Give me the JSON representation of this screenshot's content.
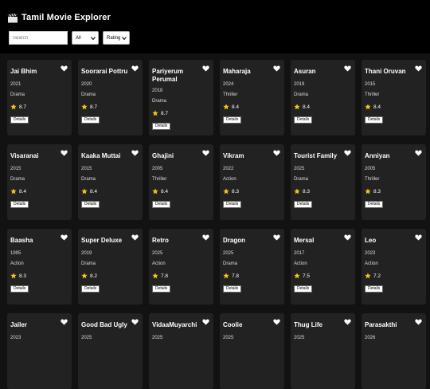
{
  "header": {
    "title": "Tamil Movie Explorer",
    "icon": "clapperboard-icon",
    "search": {
      "placeholder": "Search",
      "value": ""
    },
    "genre_filter": {
      "selected": "All"
    },
    "sort_select": {
      "selected": "Rating"
    }
  },
  "colors": {
    "background": "#121212",
    "header": "#000000",
    "card": "#222222",
    "star": "#f5c518"
  },
  "details_label": "Details",
  "movies": [
    {
      "title": "Jai Bhim",
      "year": "2021",
      "genre": "Drama",
      "rating": "8.7"
    },
    {
      "title": "Soorarai Pottru",
      "year": "2020",
      "genre": "Drama",
      "rating": "8.7"
    },
    {
      "title": "Pariyerum Perumal",
      "year": "2018",
      "genre": "Drama",
      "rating": "8.7"
    },
    {
      "title": "Maharaja",
      "year": "2024",
      "genre": "Thriller",
      "rating": "8.4"
    },
    {
      "title": "Asuran",
      "year": "2019",
      "genre": "Drama",
      "rating": "8.4"
    },
    {
      "title": "Thani Oruvan",
      "year": "2015",
      "genre": "Thriller",
      "rating": "8.4"
    },
    {
      "title": "Visaranai",
      "year": "2015",
      "genre": "Drama",
      "rating": "8.4"
    },
    {
      "title": "Kaaka Muttai",
      "year": "2015",
      "genre": "Drama",
      "rating": "8.4"
    },
    {
      "title": "Ghajini",
      "year": "2005",
      "genre": "Thriller",
      "rating": "8.4"
    },
    {
      "title": "Vikram",
      "year": "2022",
      "genre": "Action",
      "rating": "8.3"
    },
    {
      "title": "Tourist Family",
      "year": "2025",
      "genre": "Drama",
      "rating": "8.3"
    },
    {
      "title": "Anniyan",
      "year": "2005",
      "genre": "Thriller",
      "rating": "8.3"
    },
    {
      "title": "Baasha",
      "year": "1995",
      "genre": "Action",
      "rating": "8.3"
    },
    {
      "title": "Super Deluxe",
      "year": "2019",
      "genre": "Drama",
      "rating": "8.2"
    },
    {
      "title": "Retro",
      "year": "2025",
      "genre": "Action",
      "rating": "7.8"
    },
    {
      "title": "Dragon",
      "year": "2025",
      "genre": "Drama",
      "rating": "7.8"
    },
    {
      "title": "Mersal",
      "year": "2017",
      "genre": "Action",
      "rating": "7.5"
    },
    {
      "title": "Leo",
      "year": "2023",
      "genre": "Action",
      "rating": "7.2"
    },
    {
      "title": "Jailer",
      "year": "2023",
      "genre": "",
      "rating": ""
    },
    {
      "title": "Good Bad Ugly",
      "year": "2025",
      "genre": "",
      "rating": ""
    },
    {
      "title": "VidaaMuyarchi",
      "year": "2025",
      "genre": "",
      "rating": ""
    },
    {
      "title": "Coolie",
      "year": "2025",
      "genre": "",
      "rating": ""
    },
    {
      "title": "Thug Life",
      "year": "2025",
      "genre": "",
      "rating": ""
    },
    {
      "title": "Parasakthi",
      "year": "2026",
      "genre": "",
      "rating": ""
    }
  ]
}
